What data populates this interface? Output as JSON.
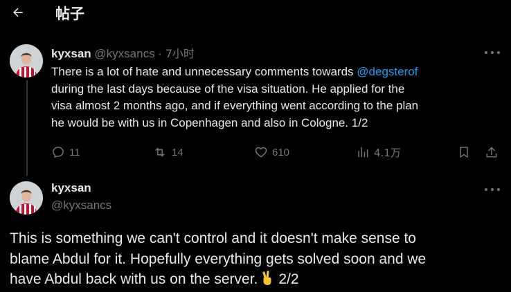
{
  "header": {
    "title": "帖子"
  },
  "tweets": [
    {
      "name": "kyxsan",
      "handle": "@kyxsancs",
      "separator": " · ",
      "time": "7小时",
      "body_lines": [
        {
          "pre": "There is a lot of hate and unnecessary comments towards ",
          "mention": "@degsterof"
        },
        {
          "text": "during the last days because of the visa situation. He applied for the"
        },
        {
          "text": "visa almost 2 months ago, and if everything went according to the plan"
        },
        {
          "text": "he would be with us in Copenhagen and also in Cologne. 1/2"
        }
      ],
      "stats": {
        "replies": "11",
        "retweets": "14",
        "likes": "610",
        "views": "4.1万"
      }
    },
    {
      "name": "kyxsan",
      "handle": "@kyxsancs",
      "body_lines": [
        "This is something we can't control and it doesn't make sense to",
        "blame Abdul for it. Hopefully everything gets solved soon and we",
        "have Abdul back with us on the server."
      ],
      "suffix": "2/2"
    }
  ],
  "colors": {
    "background": "#000000",
    "text": "#e7e9ea",
    "muted": "#71767b",
    "link": "#1d9bf0",
    "thread_line": "#333639"
  },
  "icons": [
    "back-arrow-icon",
    "more-icon",
    "reply-icon",
    "retweet-icon",
    "like-icon",
    "views-icon",
    "bookmark-icon",
    "share-icon",
    "victory-hand-emoji"
  ]
}
